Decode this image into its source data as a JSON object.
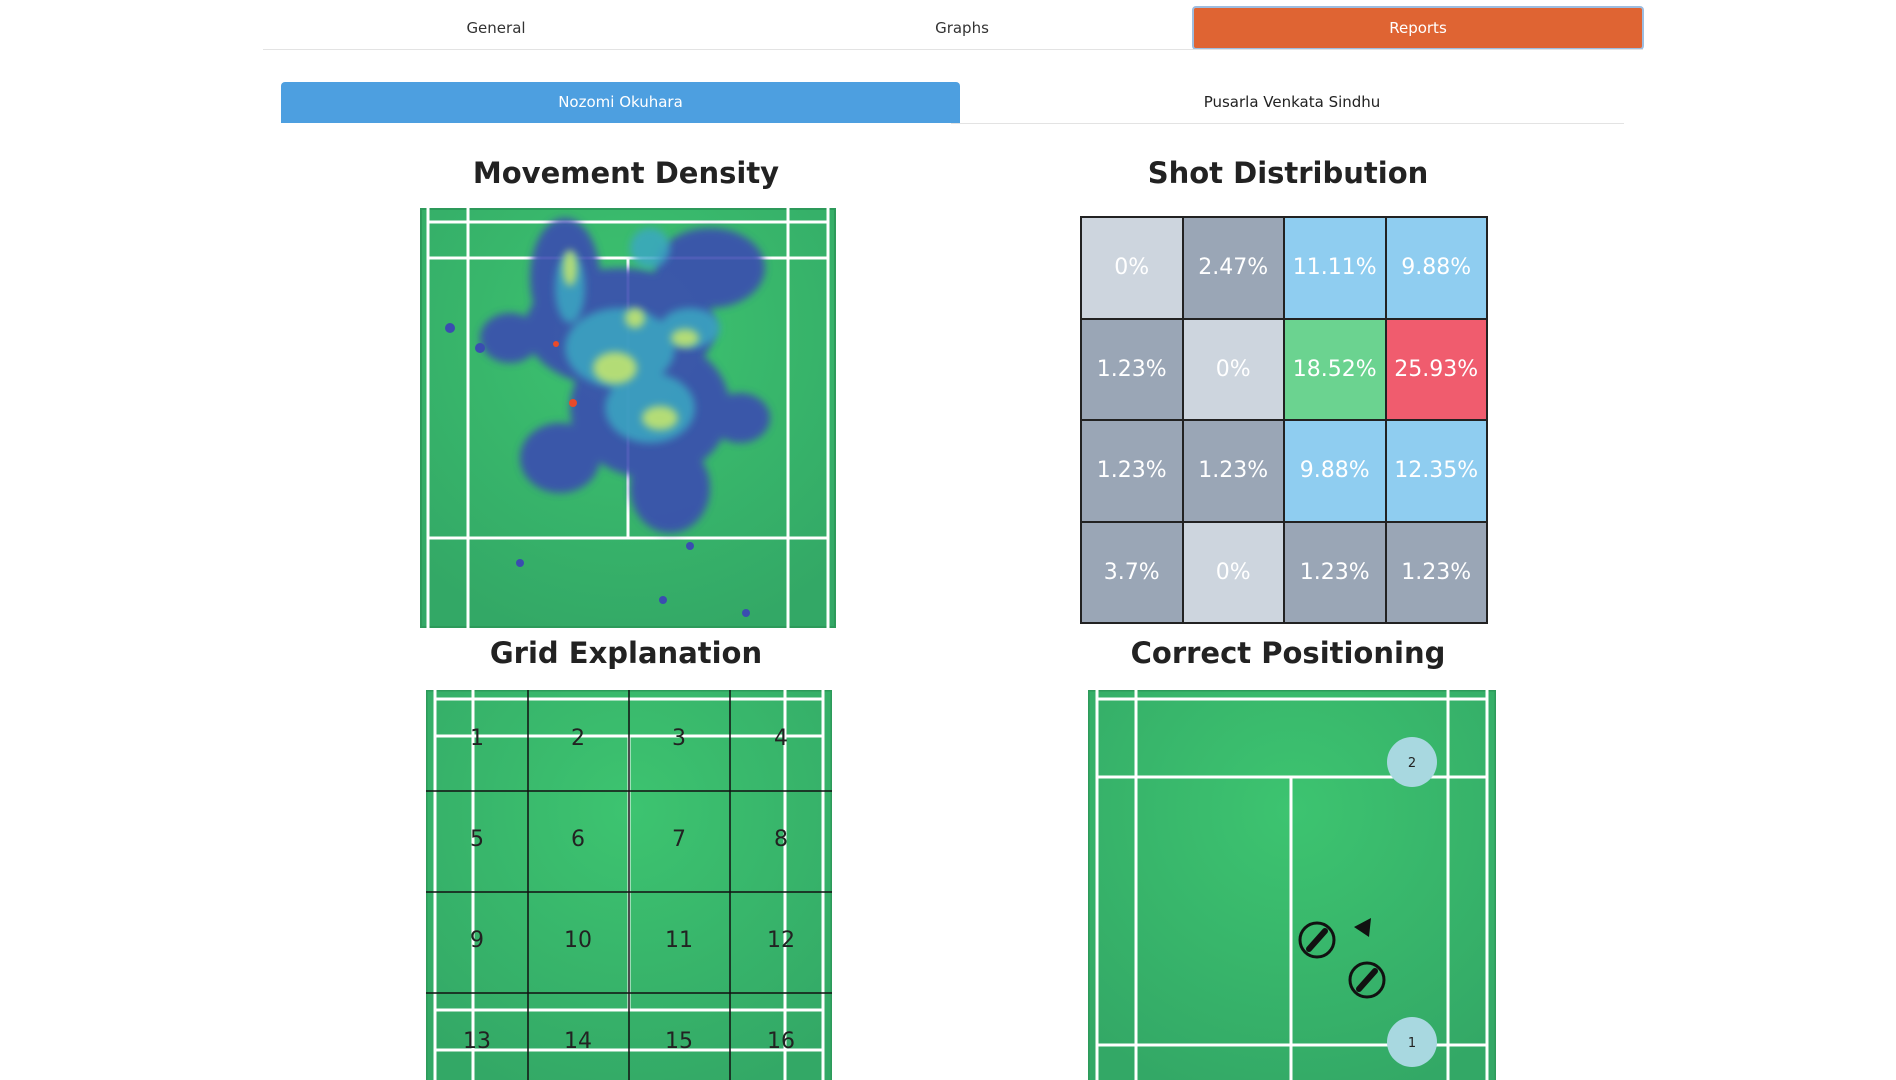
{
  "top_tabs": [
    {
      "label": "General",
      "active": false
    },
    {
      "label": "Graphs",
      "active": false
    },
    {
      "label": "Reports",
      "active": true
    }
  ],
  "player_tabs": [
    {
      "label": "Nozomi Okuhara",
      "active": true
    },
    {
      "label": "Pusarla Venkata Sindhu",
      "active": false
    }
  ],
  "sections": {
    "movement_density": "Movement Density",
    "shot_distribution": "Shot Distribution",
    "grid_explanation": "Grid Explanation",
    "correct_positioning": "Correct Positioning"
  },
  "shot_distribution": {
    "cells": [
      {
        "value": "0%",
        "color": "#cdd5de"
      },
      {
        "value": "2.47%",
        "color": "#9aa6b6"
      },
      {
        "value": "11.11%",
        "color": "#8fcdf0"
      },
      {
        "value": "9.88%",
        "color": "#8fcdf0"
      },
      {
        "value": "1.23%",
        "color": "#9aa6b6"
      },
      {
        "value": "0%",
        "color": "#cdd5de"
      },
      {
        "value": "18.52%",
        "color": "#6bd390"
      },
      {
        "value": "25.93%",
        "color": "#f05c6e"
      },
      {
        "value": "1.23%",
        "color": "#9aa6b6"
      },
      {
        "value": "1.23%",
        "color": "#9aa6b6"
      },
      {
        "value": "9.88%",
        "color": "#8fcdf0"
      },
      {
        "value": "12.35%",
        "color": "#8fcdf0"
      },
      {
        "value": "3.7%",
        "color": "#9aa6b6"
      },
      {
        "value": "0%",
        "color": "#cdd5de"
      },
      {
        "value": "1.23%",
        "color": "#9aa6b6"
      },
      {
        "value": "1.23%",
        "color": "#9aa6b6"
      }
    ]
  },
  "grid_explanation": {
    "labels": [
      "1",
      "2",
      "3",
      "4",
      "5",
      "6",
      "7",
      "8",
      "9",
      "10",
      "11",
      "12",
      "13",
      "14",
      "15",
      "16"
    ]
  },
  "correct_positioning": {
    "markers": [
      {
        "label": "2"
      },
      {
        "label": "1"
      }
    ],
    "icons": [
      "shuttle-icon",
      "shuttle-icon",
      "arrow-left-icon"
    ]
  },
  "colors": {
    "court": "#3dbd6e",
    "court_line": "#ffffff",
    "tab_active": "#df6433",
    "player_tab_active": "#4d9fe0"
  }
}
